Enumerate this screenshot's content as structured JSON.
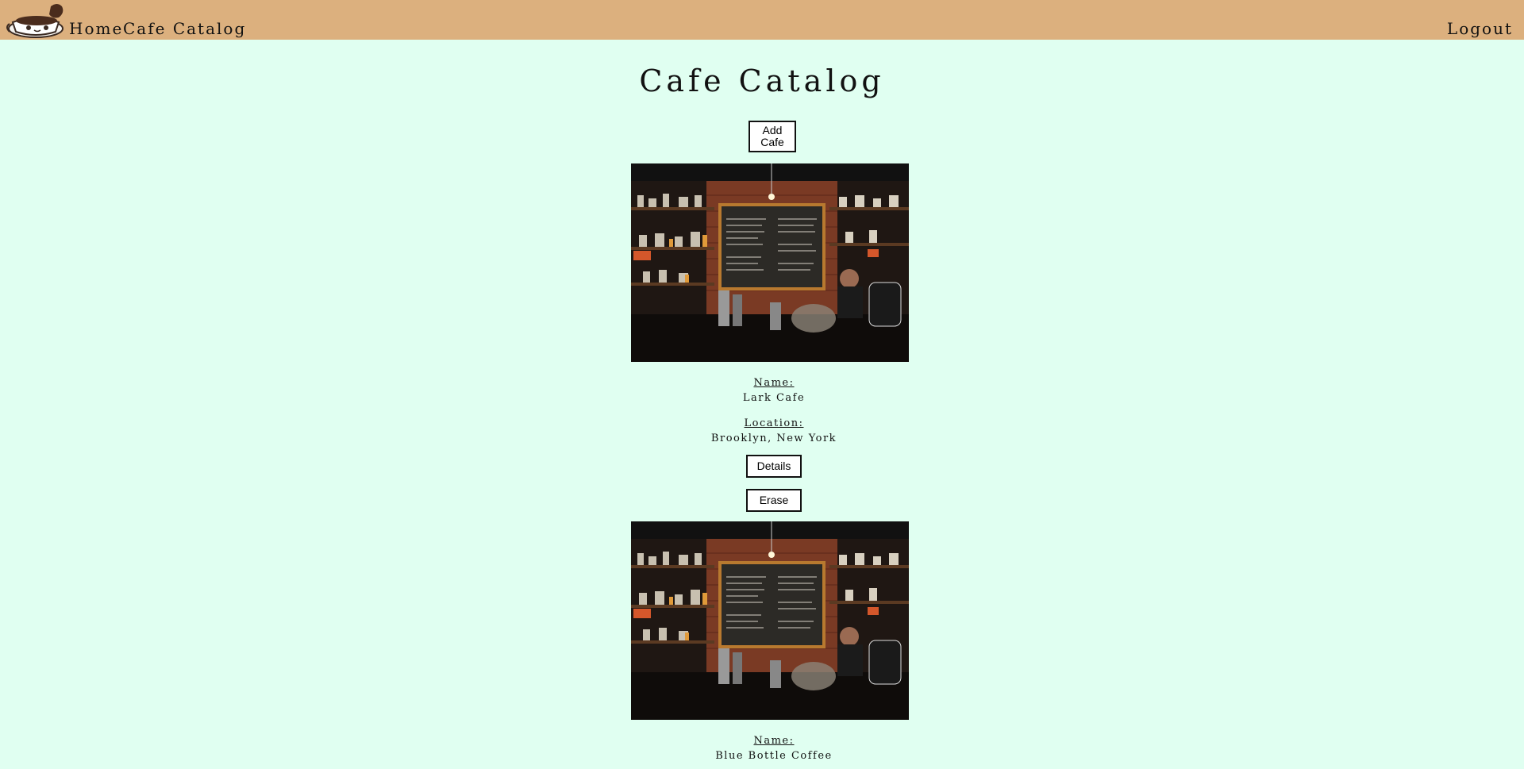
{
  "header": {
    "logo_icon": "coffee-cup-logo-icon",
    "home_label": "Home",
    "catalog_label": "Cafe Catalog",
    "logout_label": "Logout"
  },
  "page": {
    "title": "Cafe Catalog",
    "add_button_label": "Add\nCafe"
  },
  "cafes": [
    {
      "image_icon": "cafe-interior-photo",
      "name_label": "Name:",
      "name": "Lark Cafe",
      "location_label": "Location:",
      "location": "Brooklyn, New York",
      "details_label": "Details",
      "erase_label": "Erase"
    },
    {
      "image_icon": "cafe-interior-photo",
      "name_label": "Name:",
      "name": "Blue Bottle Coffee"
    }
  ],
  "colors": {
    "header_bg": "#dcb07e",
    "page_bg": "#e0fff1",
    "button_border": "#111111"
  }
}
